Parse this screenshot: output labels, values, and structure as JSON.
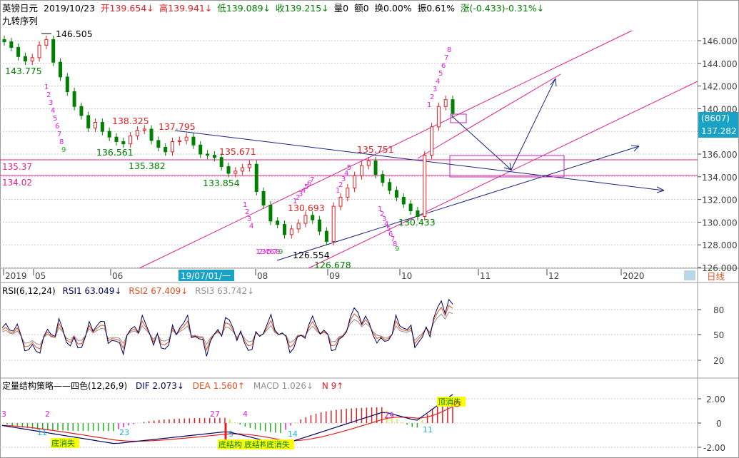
{
  "header": {
    "symbol": "英镑日元",
    "date": "2019/10/23",
    "open": "开139.654↓",
    "high": "高139.941↓",
    "low": "低139.089↓",
    "close": "收139.215↓",
    "volume": "量0",
    "amount": "额0",
    "turnover": "换0.00%",
    "amplitude": "振0.61%",
    "change": "涨(-0.433)-0.31%↓",
    "indicator_name": "九转序列"
  },
  "colors": {
    "up": "#e02020",
    "down": "#008000",
    "td": "#e020e0",
    "td_done": "#20b020",
    "trend_pink": "#e0208c",
    "trend_blue": "#1a237e",
    "rsi1": "#000060",
    "rsi2": "#e05020",
    "rsi3": "#909090",
    "axis_text": "#404040",
    "cyan_label": "#1ab0d0"
  },
  "price_panel": {
    "y_ticks": [
      "146.000",
      "144.000",
      "142.000",
      "140.000",
      "138.000",
      "136.000",
      "134.000",
      "132.000",
      "130.000",
      "128.000",
      "126.000"
    ],
    "current_tag_top": "(8607)",
    "current_tag_price": "137.282",
    "hline_labels": [
      "135.37",
      "134.02"
    ],
    "annotations": [
      "146.505",
      "143.775",
      "138.325",
      "137.795",
      "136.561",
      "135.382",
      "135.671",
      "133.854",
      "135.751",
      "130.693",
      "130.433",
      "126.554",
      "126.678"
    ],
    "td_labels": [
      "1",
      "2",
      "3",
      "4",
      "5",
      "6",
      "7",
      "8",
      "9"
    ]
  },
  "x_axis": {
    "labels": [
      "2019",
      "05",
      "06",
      "08",
      "09",
      "10",
      "11",
      "12",
      "2020"
    ],
    "cursor_label": "19/07/01/一",
    "period_label": "日线"
  },
  "rsi_panel": {
    "title": "RSI(6,12,24)",
    "rsi1": "RSI1 63.049↓",
    "rsi2": "RSI2 67.409↓",
    "rsi3": "RSI3 63.742↓",
    "y_ticks": [
      "80",
      "50",
      "20"
    ]
  },
  "macd_panel": {
    "title": "定量结构策略——四色(12,26,9)",
    "dif": "DIF 2.073↓",
    "dea": "DEA 1.560↑",
    "macd": "MACD 1.026↓",
    "n": "N 9↑",
    "y_ticks": [
      "2.00",
      "0",
      "-2.00"
    ],
    "labels": [
      "3",
      "2",
      "11",
      "23",
      "27",
      "4",
      "5",
      "14",
      "29",
      "11"
    ],
    "signal_labels": [
      "底消失",
      "底结构",
      "底结构",
      "底消失",
      "顶消失"
    ]
  },
  "chart_data": {
    "type": "candlestick",
    "title": "英镑日元 2019/10/23",
    "x_range": [
      "2019-04",
      "2020-01"
    ],
    "ylim": [
      126,
      146.8
    ],
    "price_levels": [
      135.37,
      134.02
    ],
    "key_points": [
      {
        "label": "146.505",
        "value": 146.505,
        "kind": "high"
      },
      {
        "label": "143.775",
        "value": 143.775,
        "kind": "low"
      },
      {
        "label": "138.325",
        "value": 138.325,
        "kind": "high"
      },
      {
        "label": "137.795",
        "value": 137.795,
        "kind": "high"
      },
      {
        "label": "136.561",
        "value": 136.561,
        "kind": "low"
      },
      {
        "label": "135.382",
        "value": 135.382,
        "kind": "low"
      },
      {
        "label": "135.671",
        "value": 135.671,
        "kind": "high"
      },
      {
        "label": "133.854",
        "value": 133.854,
        "kind": "low"
      },
      {
        "label": "135.751",
        "value": 135.751,
        "kind": "high"
      },
      {
        "label": "130.693",
        "value": 130.693,
        "kind": "high"
      },
      {
        "label": "130.433",
        "value": 130.433,
        "kind": "low"
      },
      {
        "label": "126.554",
        "value": 126.554,
        "kind": "low"
      },
      {
        "label": "126.678",
        "value": 126.678,
        "kind": "low"
      }
    ],
    "close_path": [
      145.9,
      145.4,
      144.6,
      144.2,
      144.5,
      145.6,
      146.1,
      144.1,
      142.8,
      141.5,
      140.2,
      139.4,
      138.3,
      138.8,
      138.0,
      137.5,
      137.1,
      136.9,
      137.6,
      138.1,
      138.2,
      137.2,
      136.6,
      136.2,
      137.1,
      137.2,
      137.5,
      136.8,
      136.0,
      135.9,
      135.7,
      134.9,
      134.3,
      134.5,
      134.8,
      135.1,
      132.7,
      131.5,
      130.1,
      129.8,
      128.9,
      129.4,
      129.9,
      130.6,
      130.2,
      129.2,
      128.3,
      131.4,
      132.2,
      133.0,
      134.1,
      135.0,
      135.4,
      134.2,
      133.5,
      132.8,
      132.2,
      131.6,
      131.0,
      130.5,
      135.9,
      138.4,
      140.2,
      140.8,
      139.6
    ],
    "rsi_scale": [
      0,
      100
    ],
    "rsi_latest": {
      "RSI1": 63.049,
      "RSI2": 67.409,
      "RSI3": 63.742
    },
    "macd_latest": {
      "DIF": 2.073,
      "DEA": 1.56,
      "MACD": 1.026,
      "N": 9
    }
  }
}
